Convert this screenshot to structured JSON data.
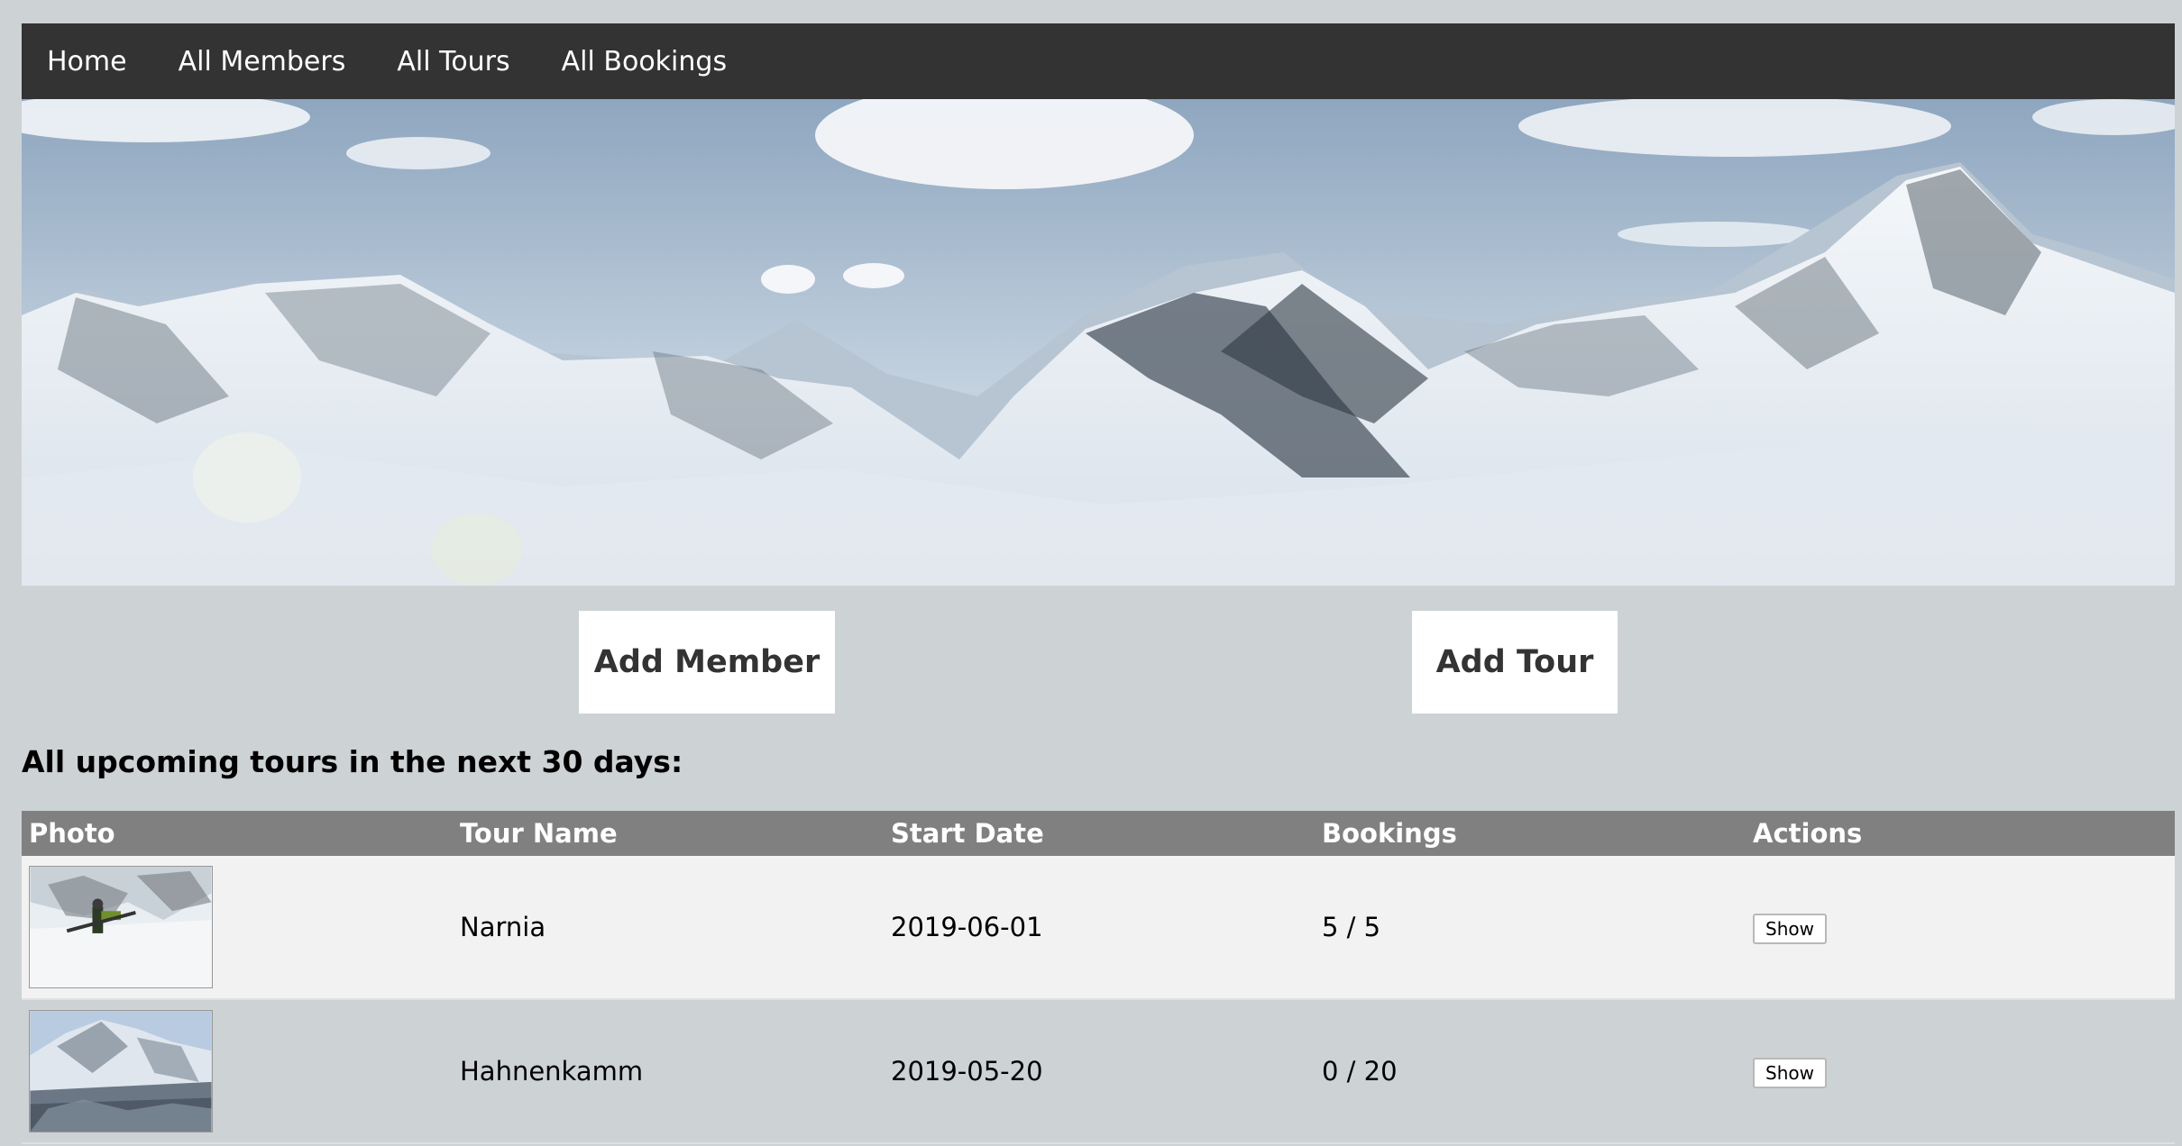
{
  "nav": {
    "links": [
      {
        "label": "Home"
      },
      {
        "label": "All Members"
      },
      {
        "label": "All Tours"
      },
      {
        "label": "All Bookings"
      }
    ]
  },
  "actions": {
    "add_member_label": "Add Member",
    "add_tour_label": "Add Tour"
  },
  "upcoming": {
    "heading": "All upcoming tours in the next 30 days:",
    "columns": [
      "Photo",
      "Tour Name",
      "Start Date",
      "Bookings",
      "Actions"
    ],
    "rows": [
      {
        "tour_name": "Narnia",
        "start_date": "2019-06-01",
        "bookings": "5 / 5",
        "action_label": "Show"
      },
      {
        "tour_name": "Hahnenkamm",
        "start_date": "2019-05-20",
        "bookings": "0 / 20",
        "action_label": "Show"
      }
    ]
  }
}
